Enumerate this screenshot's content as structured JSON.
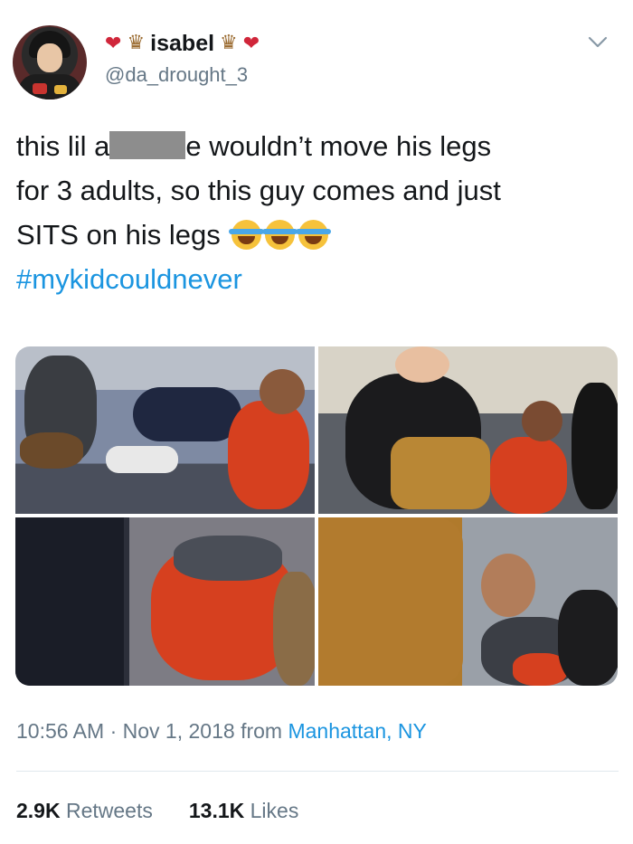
{
  "tweet": {
    "display_name": "isabel",
    "handle": "@da_drought_3",
    "text_line1_start": "this lil a",
    "text_line1_end": "e wouldn’t move his legs",
    "text_line2": "for 3 adults, so this guy comes and just",
    "text_line3": "SITS on his legs",
    "hashtag": "#mykidcouldnever",
    "time": "10:56 AM",
    "dot": "·",
    "date": "Nov 1, 2018",
    "from_label": "from",
    "location": "Manhattan, NY",
    "retweets_count": "2.9K",
    "retweets_label": "Retweets",
    "likes_count": "13.1K",
    "likes_label": "Likes",
    "name_emoji_left": [
      "heart-icon",
      "trophy-icon"
    ],
    "name_emoji_right": [
      "trophy-icon",
      "heart-icon"
    ],
    "text_emoji": [
      "crying-laughing-emoji",
      "crying-laughing-emoji",
      "crying-laughing-emoji"
    ]
  },
  "colors": {
    "link": "#1b95e0",
    "secondary_text": "#657786",
    "primary_text": "#14171a"
  }
}
